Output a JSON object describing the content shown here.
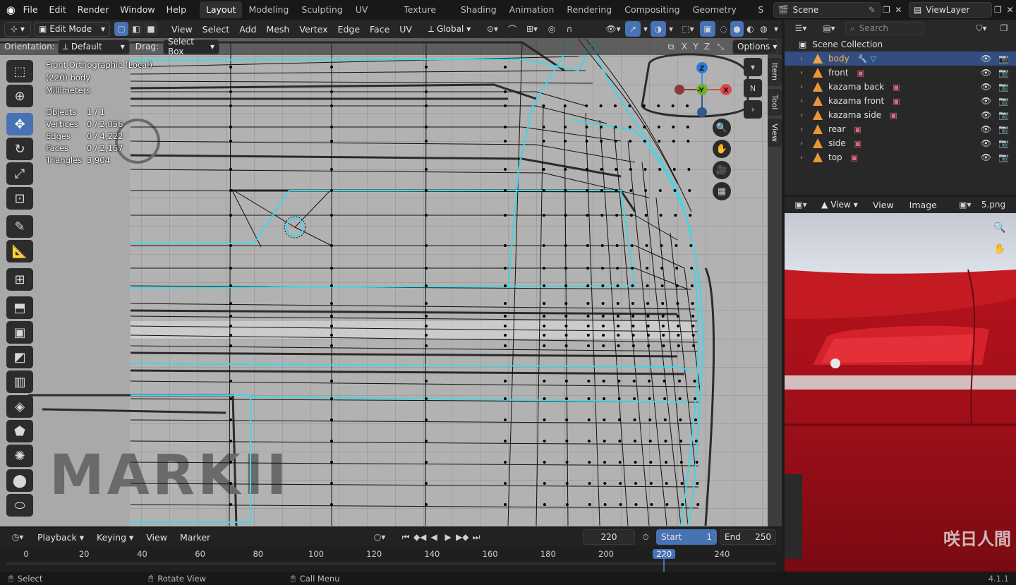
{
  "topbar": {
    "menus": [
      "File",
      "Edit",
      "Render",
      "Window",
      "Help"
    ],
    "workspaces": [
      "Layout",
      "Modeling",
      "Sculpting",
      "UV Editing",
      "Texture Paint",
      "Shading",
      "Animation",
      "Rendering",
      "Compositing",
      "Geometry Nodes",
      "S"
    ],
    "active_workspace": "Layout",
    "scene": "Scene",
    "view_layer": "ViewLayer"
  },
  "viewport_header": {
    "mode": "Edit Mode",
    "menus": [
      "View",
      "Select",
      "Add",
      "Mesh",
      "Vertex",
      "Edge",
      "Face",
      "UV"
    ],
    "transform_orientation": "Global",
    "orientation_label": "Orientation:",
    "orientation_value": "Default",
    "drag_label": "Drag:",
    "drag_value": "Select Box",
    "axes": [
      "X",
      "Y",
      "Z"
    ],
    "options_label": "Options"
  },
  "overlay": {
    "view_name": "Front Orthographic (Local)",
    "object_name": "(220) body",
    "units": "Millimeters",
    "stats": [
      {
        "label": "Objects",
        "value": "1 / 1"
      },
      {
        "label": "Vertices",
        "value": "0 / 2,056"
      },
      {
        "label": "Edges",
        "value": "0 / 4,222"
      },
      {
        "label": "Faces",
        "value": "0 / 2,167"
      },
      {
        "label": "Triangles",
        "value": "3,904"
      }
    ],
    "background_text": "MARKII"
  },
  "gizmo": {
    "z": "Z",
    "y": "-Y",
    "x": "X",
    "n_label": "N"
  },
  "side_tabs": [
    "Item",
    "Tool",
    "View"
  ],
  "outliner": {
    "search_placeholder": "Search",
    "collection": "Scene Collection",
    "items": [
      {
        "name": "body",
        "selected": true
      },
      {
        "name": "front",
        "selected": false
      },
      {
        "name": "kazama back",
        "selected": false
      },
      {
        "name": "kazama front",
        "selected": false
      },
      {
        "name": "kazama side",
        "selected": false
      },
      {
        "name": "rear",
        "selected": false
      },
      {
        "name": "side",
        "selected": false
      },
      {
        "name": "top",
        "selected": false
      }
    ]
  },
  "image_editor": {
    "view_label": "View",
    "menus": [
      "View",
      "Image"
    ],
    "image_name": "5.png",
    "watermark": "咲日人間"
  },
  "timeline": {
    "menus": [
      "Playback",
      "Keying",
      "View",
      "Marker"
    ],
    "current_frame": "220",
    "start_label": "Start",
    "start": "1",
    "end_label": "End",
    "end": "250",
    "ticks": [
      "0",
      "20",
      "40",
      "60",
      "80",
      "100",
      "120",
      "140",
      "160",
      "180",
      "200",
      "220",
      "240"
    ]
  },
  "statusbar": {
    "hints": [
      "Select",
      "Rotate View",
      "Call Menu"
    ],
    "version": "4.1.1"
  },
  "colors": {
    "accent": "#4772b3",
    "wire_selected": "#3fd7e6",
    "frame_marker": "#4772b3"
  }
}
